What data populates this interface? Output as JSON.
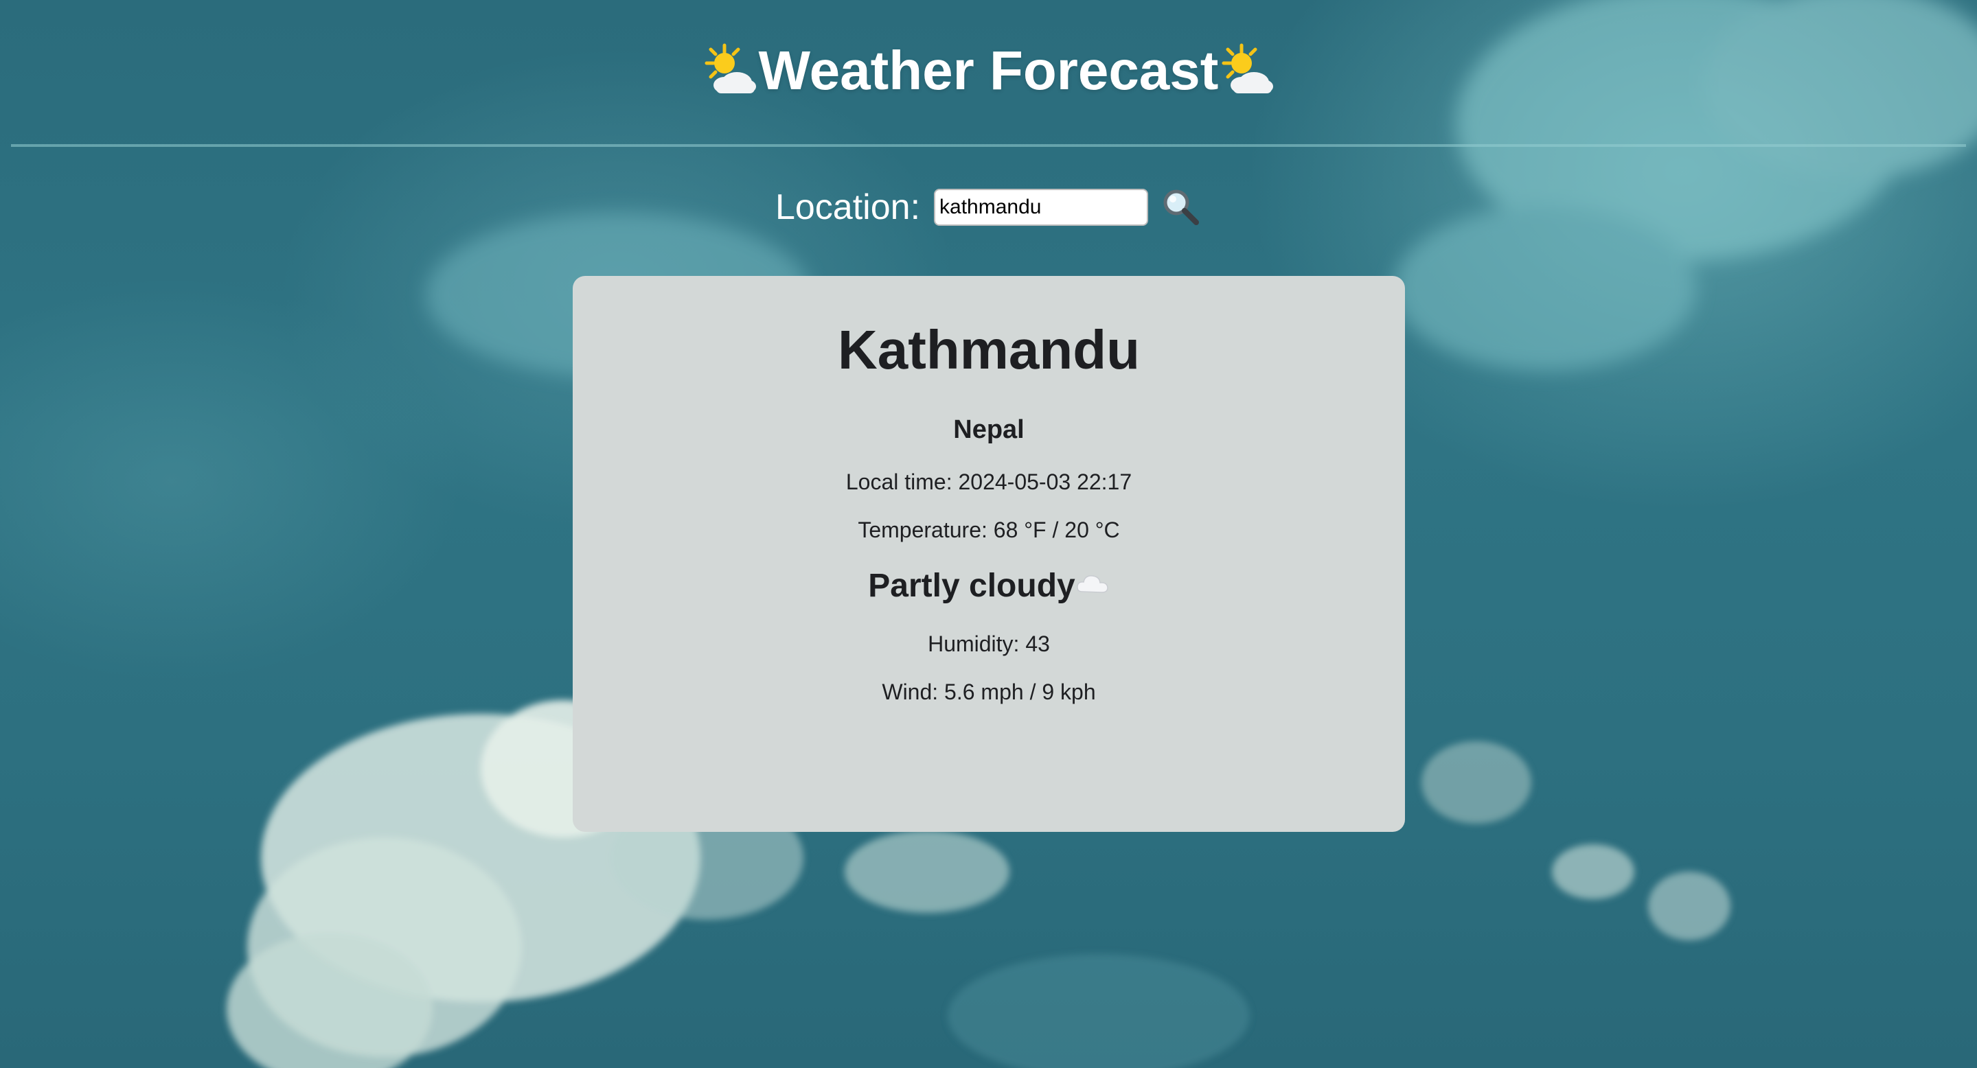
{
  "header": {
    "title": "Weather Forecast",
    "icon": "sun-behind-cloud-icon"
  },
  "search": {
    "label": "Location:",
    "value": "kathmandu",
    "button_icon": "magnifying-glass-icon"
  },
  "weather": {
    "city": "Kathmandu",
    "country": "Nepal",
    "local_time": "Local time: 2024-05-03 22:17",
    "temperature": "Temperature: 68 °F / 20 °C",
    "condition": "Partly cloudy",
    "condition_icon": "cloud-icon",
    "humidity": "Humidity: 43",
    "wind": "Wind: 5.6 mph / 9 kph"
  },
  "colors": {
    "background": "#2d7080",
    "card": "#d3d8d7",
    "text": "#1e1f22",
    "header_text": "#ffffff"
  }
}
